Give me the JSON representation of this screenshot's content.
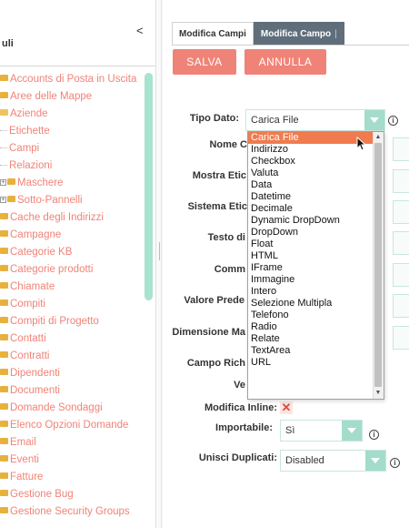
{
  "sidebar": {
    "title": "uli",
    "collapse_glyph": "<",
    "items": [
      {
        "label": "Accounts di Posta in Uscita",
        "icon": "folder-icon",
        "indent": 0
      },
      {
        "label": "Aree delle Mappe",
        "icon": "folder-icon",
        "indent": 0
      },
      {
        "label": "Aziende",
        "icon": "folder-open-icon",
        "indent": 0
      },
      {
        "label": "Etichette",
        "icon": "none",
        "indent": 1
      },
      {
        "label": "Campi",
        "icon": "none",
        "indent": 1
      },
      {
        "label": "Relazioni",
        "icon": "none",
        "indent": 1
      },
      {
        "label": "Maschere",
        "icon": "folder-icon",
        "indent": 1,
        "expandable": true
      },
      {
        "label": "Sotto-Pannelli",
        "icon": "folder-icon",
        "indent": 1,
        "expandable": true
      },
      {
        "label": "Cache degli Indirizzi",
        "icon": "folder-icon",
        "indent": 0
      },
      {
        "label": "Campagne",
        "icon": "folder-icon",
        "indent": 0
      },
      {
        "label": "Categorie KB",
        "icon": "folder-icon",
        "indent": 0
      },
      {
        "label": "Categorie prodotti",
        "icon": "folder-icon",
        "indent": 0
      },
      {
        "label": "Chiamate",
        "icon": "folder-icon",
        "indent": 0
      },
      {
        "label": "Compiti",
        "icon": "folder-icon",
        "indent": 0
      },
      {
        "label": "Compiti di Progetto",
        "icon": "folder-icon",
        "indent": 0
      },
      {
        "label": "Contatti",
        "icon": "folder-icon",
        "indent": 0
      },
      {
        "label": "Contratti",
        "icon": "folder-icon",
        "indent": 0
      },
      {
        "label": "Dipendenti",
        "icon": "folder-icon",
        "indent": 0
      },
      {
        "label": "Documenti",
        "icon": "folder-icon",
        "indent": 0
      },
      {
        "label": "Domande Sondaggi",
        "icon": "folder-icon",
        "indent": 0
      },
      {
        "label": "Elenco Opzioni Domande",
        "icon": "folder-icon",
        "indent": 0
      },
      {
        "label": "Email",
        "icon": "folder-icon",
        "indent": 0
      },
      {
        "label": "Eventi",
        "icon": "folder-icon",
        "indent": 0
      },
      {
        "label": "Fatture",
        "icon": "folder-icon",
        "indent": 0
      },
      {
        "label": "Gestione Bug",
        "icon": "folder-icon",
        "indent": 0
      },
      {
        "label": "Gestione Security Groups",
        "icon": "folder-icon",
        "indent": 0
      }
    ]
  },
  "tabs": [
    {
      "label": "Modifica Campi",
      "active": false
    },
    {
      "label": "Modifica Campo",
      "active": true,
      "suffix": "|"
    }
  ],
  "buttons": {
    "save": "SALVA",
    "cancel": "ANNULLA"
  },
  "form": {
    "tipo_dato": {
      "label": "Tipo Dato:",
      "value": "Carica File"
    },
    "nome": {
      "label": "Nome C"
    },
    "mostra": {
      "label": "Mostra Etic"
    },
    "sistema": {
      "label": "Sistema Etic"
    },
    "testo": {
      "label": "Testo di"
    },
    "comm": {
      "label": "Comm"
    },
    "valore": {
      "label": "Valore Prede"
    },
    "dimensione": {
      "label": "Dimensione Ma"
    },
    "campo": {
      "label": "Campo Rich"
    },
    "ve": {
      "label": "Ve"
    },
    "modifica_inline": {
      "label": "Modifica Inline:",
      "checked_mark": "✕"
    },
    "importabile": {
      "label": "Importabile:",
      "value": "Sì"
    },
    "unisci": {
      "label": "Unisci Duplicati:",
      "value": "Disabled"
    }
  },
  "dropdown": {
    "selected": "Carica File",
    "options": [
      "Carica File",
      "Indirizzo",
      "Checkbox",
      "Valuta",
      "Data",
      "Datetime",
      "Decimale",
      "Dynamic DropDown",
      "DropDown",
      "Float",
      "HTML",
      "IFrame",
      "Immagine",
      "Intero",
      "Selezione Multipla",
      "Telefono",
      "Radio",
      "Relate",
      "TextArea",
      "URL"
    ]
  },
  "colors": {
    "accent": "#f08377",
    "select_arrow": "#a3dccb",
    "dropdown_selected": "#f07b4f",
    "scrollbar": "#a7e3cf"
  }
}
